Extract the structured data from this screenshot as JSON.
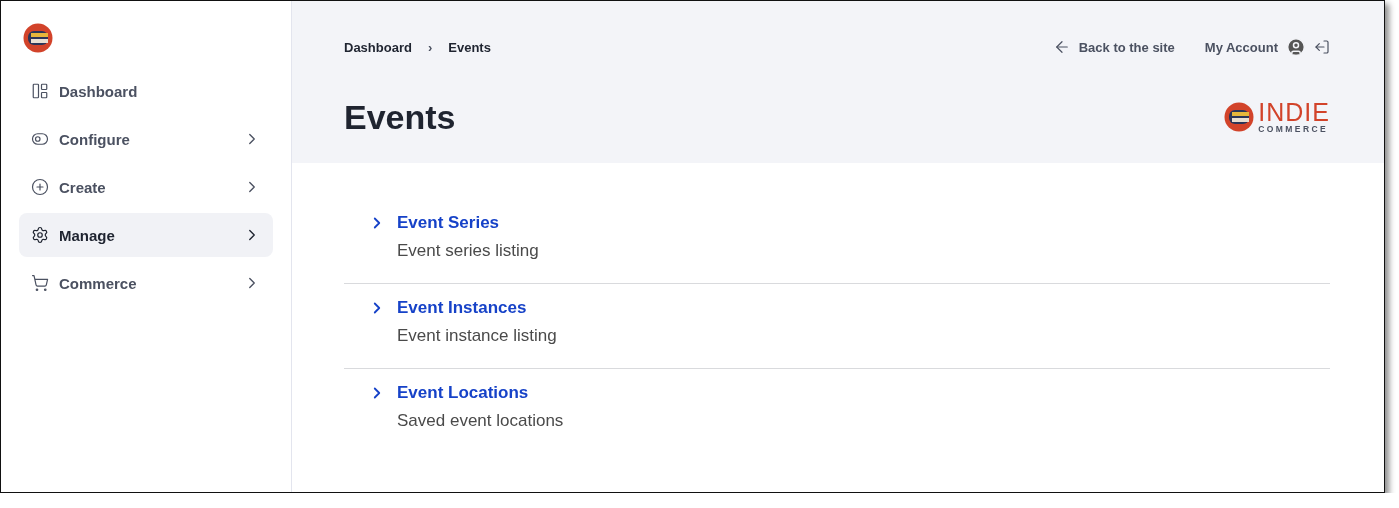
{
  "sidebar": {
    "items": [
      {
        "label": "Dashboard",
        "kind": "link",
        "selected": false
      },
      {
        "label": "Configure",
        "kind": "submenu",
        "selected": false
      },
      {
        "label": "Create",
        "kind": "submenu",
        "selected": false
      },
      {
        "label": "Manage",
        "kind": "submenu",
        "selected": true
      },
      {
        "label": "Commerce",
        "kind": "submenu",
        "selected": false
      }
    ]
  },
  "breadcrumbs": {
    "items": [
      "Dashboard",
      "Events"
    ],
    "separator": "›"
  },
  "top_links": {
    "back": "Back to the site",
    "account": "My Account"
  },
  "page_title": "Events",
  "brand": {
    "wordmark": "INDIE",
    "tagline": "COMMERCE"
  },
  "sections": [
    {
      "title": "Event Series",
      "description": "Event series listing"
    },
    {
      "title": "Event Instances",
      "description": "Event instance listing"
    },
    {
      "title": "Event Locations",
      "description": "Saved event locations"
    }
  ]
}
